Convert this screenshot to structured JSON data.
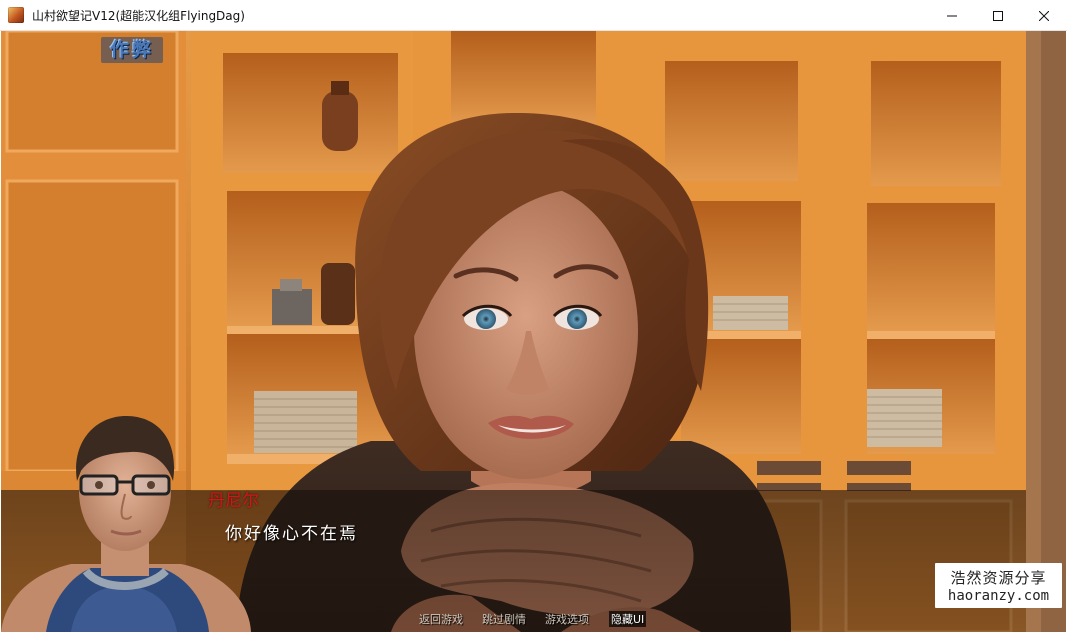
{
  "window": {
    "title": "山村欲望记V12(超能汉化组FlyingDag)",
    "controls": {
      "minimize": "—",
      "maximize": "☐",
      "close": "✕"
    }
  },
  "game": {
    "cheat_button": "作弊",
    "dialogue": {
      "speaker": "丹尼尔",
      "text": "你好像心不在焉"
    },
    "quick_menu": [
      {
        "label": "返回游戏"
      },
      {
        "label": "跳过剧情"
      },
      {
        "label": "游戏选项"
      },
      {
        "label": "隐藏UI"
      }
    ]
  },
  "watermark": {
    "line1": "浩然资源分享",
    "line2": "haoranzy.com"
  },
  "colors": {
    "speaker_name": "#d21616",
    "dialogue_text": "#ffffff",
    "cabinet_wood": "#d98a35"
  }
}
